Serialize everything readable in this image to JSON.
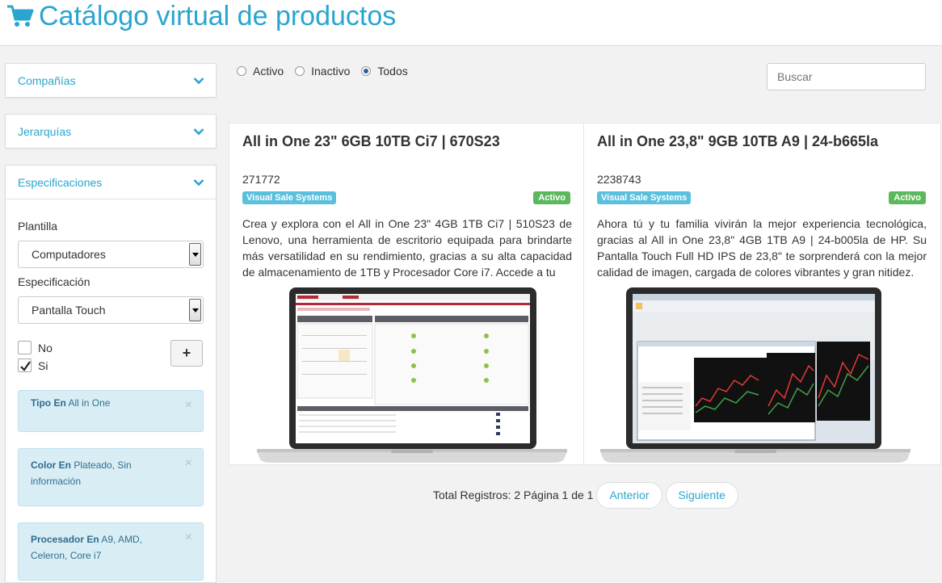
{
  "header": {
    "title": "Catálogo virtual de productos",
    "icon": "cart-icon"
  },
  "sidebar": {
    "panels": [
      {
        "label": "Compañías",
        "icon": "chevron-down-icon"
      },
      {
        "label": "Jerarquías",
        "icon": "chevron-down-icon"
      },
      {
        "label": "Especificaciones",
        "icon": "chevron-down-icon"
      }
    ],
    "spec": {
      "template_label": "Plantilla",
      "template_value": "Computadores",
      "spec_label": "Especificación",
      "spec_value": "Pantalla Touch",
      "options": [
        {
          "label": "No",
          "checked": false
        },
        {
          "label": "Si",
          "checked": true
        }
      ],
      "add_label": "+",
      "filters": [
        {
          "key": "Tipo En",
          "value": "All in One"
        },
        {
          "key": "Color En",
          "value": "Plateado, Sin información"
        },
        {
          "key": "Procesador En",
          "value": "A9, AMD, Celeron, Core i7"
        }
      ],
      "close_glyph": "×"
    }
  },
  "filters": {
    "status_options": [
      {
        "label": "Activo",
        "selected": false
      },
      {
        "label": "Inactivo",
        "selected": false
      },
      {
        "label": "Todos",
        "selected": true
      }
    ],
    "search_placeholder": "Buscar"
  },
  "products": [
    {
      "title": "All in One 23\" 6GB 10TB Ci7 | 670S23",
      "code": "271772",
      "vendor": "Visual Sale Systems",
      "status": "Activo",
      "description": "Crea y explora con el All in One 23\" 4GB 1TB Ci7 | 510S23 de Lenovo, una herramienta de escritorio equipada para brindarte más versatilidad en su rendimiento, gracias a su alta capacidad de almacenamiento de 1TB y Procesador Core i7. Accede a tu"
    },
    {
      "title": "All in One 23,8\" 9GB 10TB A9 | 24-b665la",
      "code": "2238743",
      "vendor": "Visual Sale Systems",
      "status": "Activo",
      "description": "Ahora tú y tu familia vivirán la mejor experiencia tecnológica, gracias al All in One 23,8\" 4GB 1TB A9 | 24-b005la de HP. Su Pantalla Touch Full HD IPS de 23,8\" te sorprenderá con la mejor calidad de imagen, cargada de colores vibrantes y gran nitidez."
    }
  ],
  "pagination": {
    "summary": "Total Registros: 2 Página 1 de 1",
    "prev_label": "Anterior",
    "next_label": "Siguiente"
  },
  "colors": {
    "accent": "#2aa5cf",
    "vendor_badge": "#5bc0de",
    "status_badge": "#5cb85c",
    "filter_bg": "#d9edf5"
  }
}
